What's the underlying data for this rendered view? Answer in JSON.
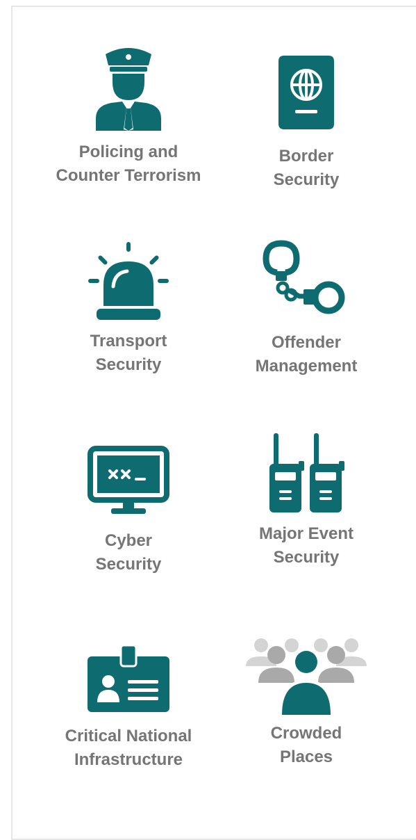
{
  "accent_color": "#0e6c70",
  "crowd_gray": "#a9a9a9",
  "crowd_light_gray": "#d4d4d4",
  "tiles": [
    {
      "icon": "police-officer-icon",
      "label": [
        "Policing and",
        "Counter Terrorism"
      ]
    },
    {
      "icon": "passport-icon",
      "label": [
        "Border",
        "Security"
      ]
    },
    {
      "icon": "siren-icon",
      "label": [
        "Transport",
        "Security"
      ]
    },
    {
      "icon": "handcuffs-icon",
      "label": [
        "Offender",
        "Management"
      ]
    },
    {
      "icon": "computer-monitor-icon",
      "label": [
        "Cyber",
        "Security"
      ]
    },
    {
      "icon": "walkie-talkie-icon",
      "label": [
        "Major Event",
        "Security"
      ]
    },
    {
      "icon": "id-badge-icon",
      "label": [
        "Critical National",
        "Infrastructure"
      ]
    },
    {
      "icon": "crowd-icon",
      "label": [
        "Crowded",
        "Places"
      ]
    }
  ]
}
